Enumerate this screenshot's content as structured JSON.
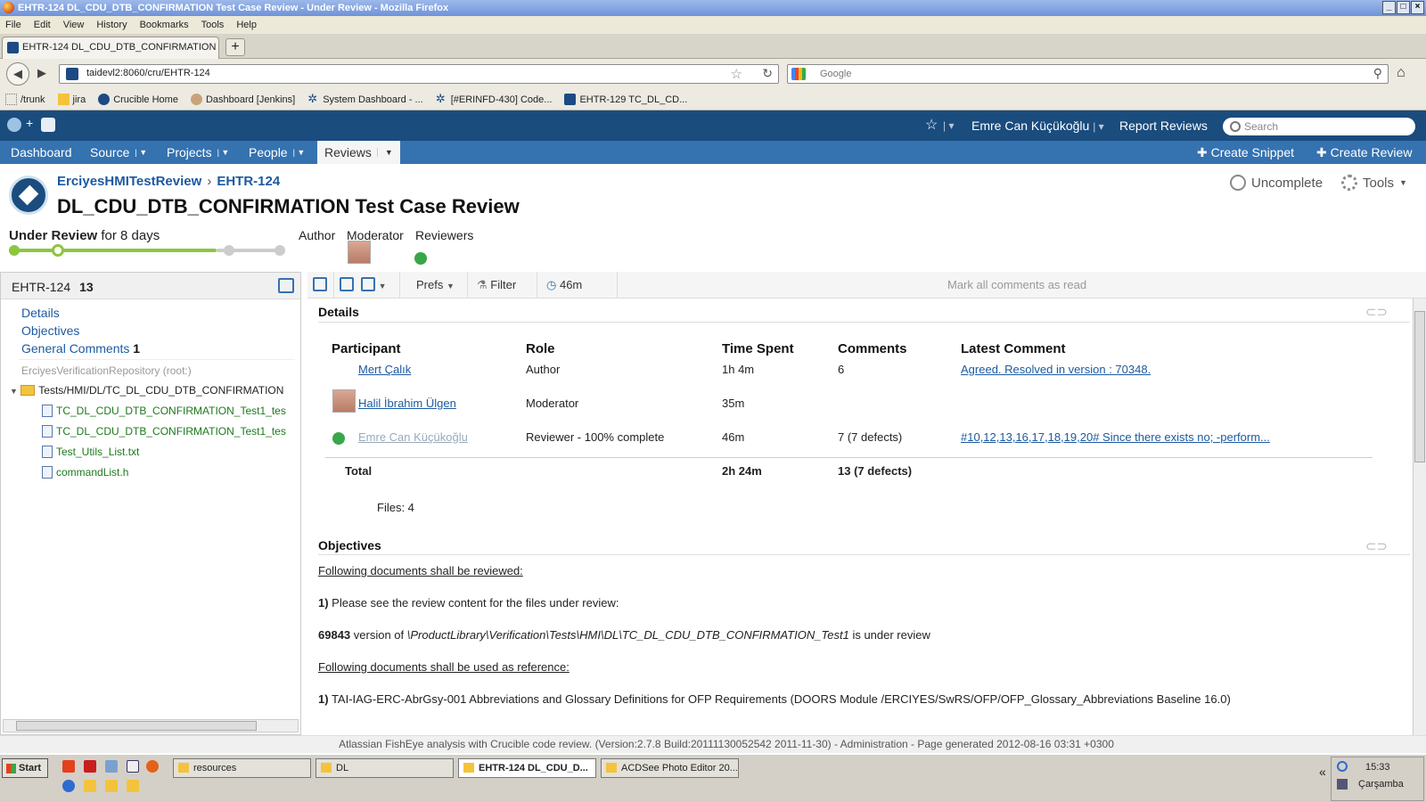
{
  "window": {
    "title": "EHTR-124 DL_CDU_DTB_CONFIRMATION Test Case Review - Under Review - Mozilla Firefox"
  },
  "menu": [
    "File",
    "Edit",
    "View",
    "History",
    "Bookmarks",
    "Tools",
    "Help"
  ],
  "browser_tab": {
    "label": "EHTR-124 DL_CDU_DTB_CONFIRMATION T...",
    "new_tab": "+"
  },
  "address": {
    "url": "taidevl2:8060/cru/EHTR-124",
    "search_placeholder": "Google"
  },
  "bookmarks": [
    "/trunk",
    "jira",
    "Crucible Home",
    "Dashboard [Jenkins]",
    "System Dashboard - ...",
    "[#ERINFD-430] Code...",
    "EHTR-129 TC_DL_CD..."
  ],
  "app_header": {
    "user": "Emre Can Küçükoğlu",
    "report": "Report Reviews",
    "search_placeholder": "Search"
  },
  "app_nav": {
    "items": [
      {
        "label": "Dashboard"
      },
      {
        "label": "Source"
      },
      {
        "label": "Projects"
      },
      {
        "label": "People"
      },
      {
        "label": "Reviews"
      }
    ],
    "create_snippet": "Create Snippet",
    "create_review": "Create Review"
  },
  "review": {
    "project": "ErciyesHMITestReview",
    "key": "EHTR-124",
    "title": "DL_CDU_DTB_CONFIRMATION Test Case Review",
    "state": "Under Review",
    "duration": "for 8 days",
    "progress_fraction": 0.75,
    "roles": {
      "author": "Author",
      "moderator": "Moderator",
      "reviewers": "Reviewers"
    },
    "uncomplete": "Uncomplete",
    "tools": "Tools"
  },
  "sidebar": {
    "key": "EHTR-124",
    "count": "13",
    "links": [
      {
        "label": "Details",
        "badge": ""
      },
      {
        "label": "Objectives",
        "badge": ""
      },
      {
        "label": "General Comments",
        "badge": "1"
      }
    ],
    "repo": "ErciyesVerificationRepository (root:)",
    "folder": "Tests/HMI/DL/TC_DL_CDU_DTB_CONFIRMATION",
    "files": [
      {
        "name": "TC_DL_CDU_DTB_CONFIRMATION_Test1_tes",
        "color": "#1c7a1c"
      },
      {
        "name": "TC_DL_CDU_DTB_CONFIRMATION_Test1_tes",
        "color": "#1c7a1c"
      },
      {
        "name": "Test_Utils_List.txt",
        "color": "#1c7a1c"
      },
      {
        "name": "commandList.h",
        "color": "#1c7a1c"
      }
    ]
  },
  "toolbar": {
    "prefs": "Prefs",
    "filter": "Filter",
    "time": "46m",
    "mark_read": "Mark all comments as read"
  },
  "details": {
    "heading": "Details",
    "headers": [
      "Participant",
      "Role",
      "Time Spent",
      "Comments",
      "Latest Comment"
    ],
    "rows": [
      {
        "name": "Mert Çalık",
        "role": "Author",
        "time": "1h 4m",
        "comments": "6",
        "latest": "Agreed. Resolved in version : 70348."
      },
      {
        "name": "Halil İbrahim Ülgen",
        "role": "Moderator",
        "time": "35m",
        "comments": "",
        "latest": ""
      },
      {
        "name": "Emre Can Küçükoğlu",
        "role": "Reviewer - 100% complete",
        "time": "46m",
        "comments": "7 (7 defects)",
        "latest": "#10,12,13,16,17,18,19,20# Since there exists no; -perform..."
      }
    ],
    "total": {
      "label": "Total",
      "time": "2h 24m",
      "comments": "13 (7 defects)"
    },
    "files": "Files: 4"
  },
  "objectives": {
    "heading": "Objectives",
    "line1": "Following documents shall be reviewed:",
    "item1_num": "1)",
    "item1_text": " Please see the review content for the files under review:",
    "version_num": "69843",
    "version_text1": " version of ",
    "version_path": "\\ProductLibrary\\Verification\\Tests\\HMI\\DL\\TC_DL_CDU_DTB_CONFIRMATION_Test1",
    "version_text2": " is under review",
    "line2": "Following documents shall be used as reference:",
    "ref_num": "1)",
    "ref_text": " TAI-IAG-ERC-AbrGsy-001 Abbreviations and Glossary Definitions for OFP Requirements (DOORS Module /ERCIYES/SwRS/OFP/OFP_Glossary_Abbreviations Baseline 16.0)"
  },
  "footer": "Atlassian FishEye analysis with Crucible code review. (Version:2.7.8 Build:20111130052542 2011-11-30) - Administration - Page generated 2012-08-16 03:31 +0300",
  "taskbar": {
    "start": "Start",
    "tasks": [
      "resources",
      "DL",
      "EHTR-124 DL_CDU_D...",
      "ACDSee Photo Editor 20..."
    ],
    "time": "15:33",
    "day": "Çarşamba"
  },
  "colors": {
    "app_header": "#1a4c7e",
    "app_nav": "#3572b0",
    "link": "#1d5aa0",
    "progress": "#8cc63f"
  }
}
